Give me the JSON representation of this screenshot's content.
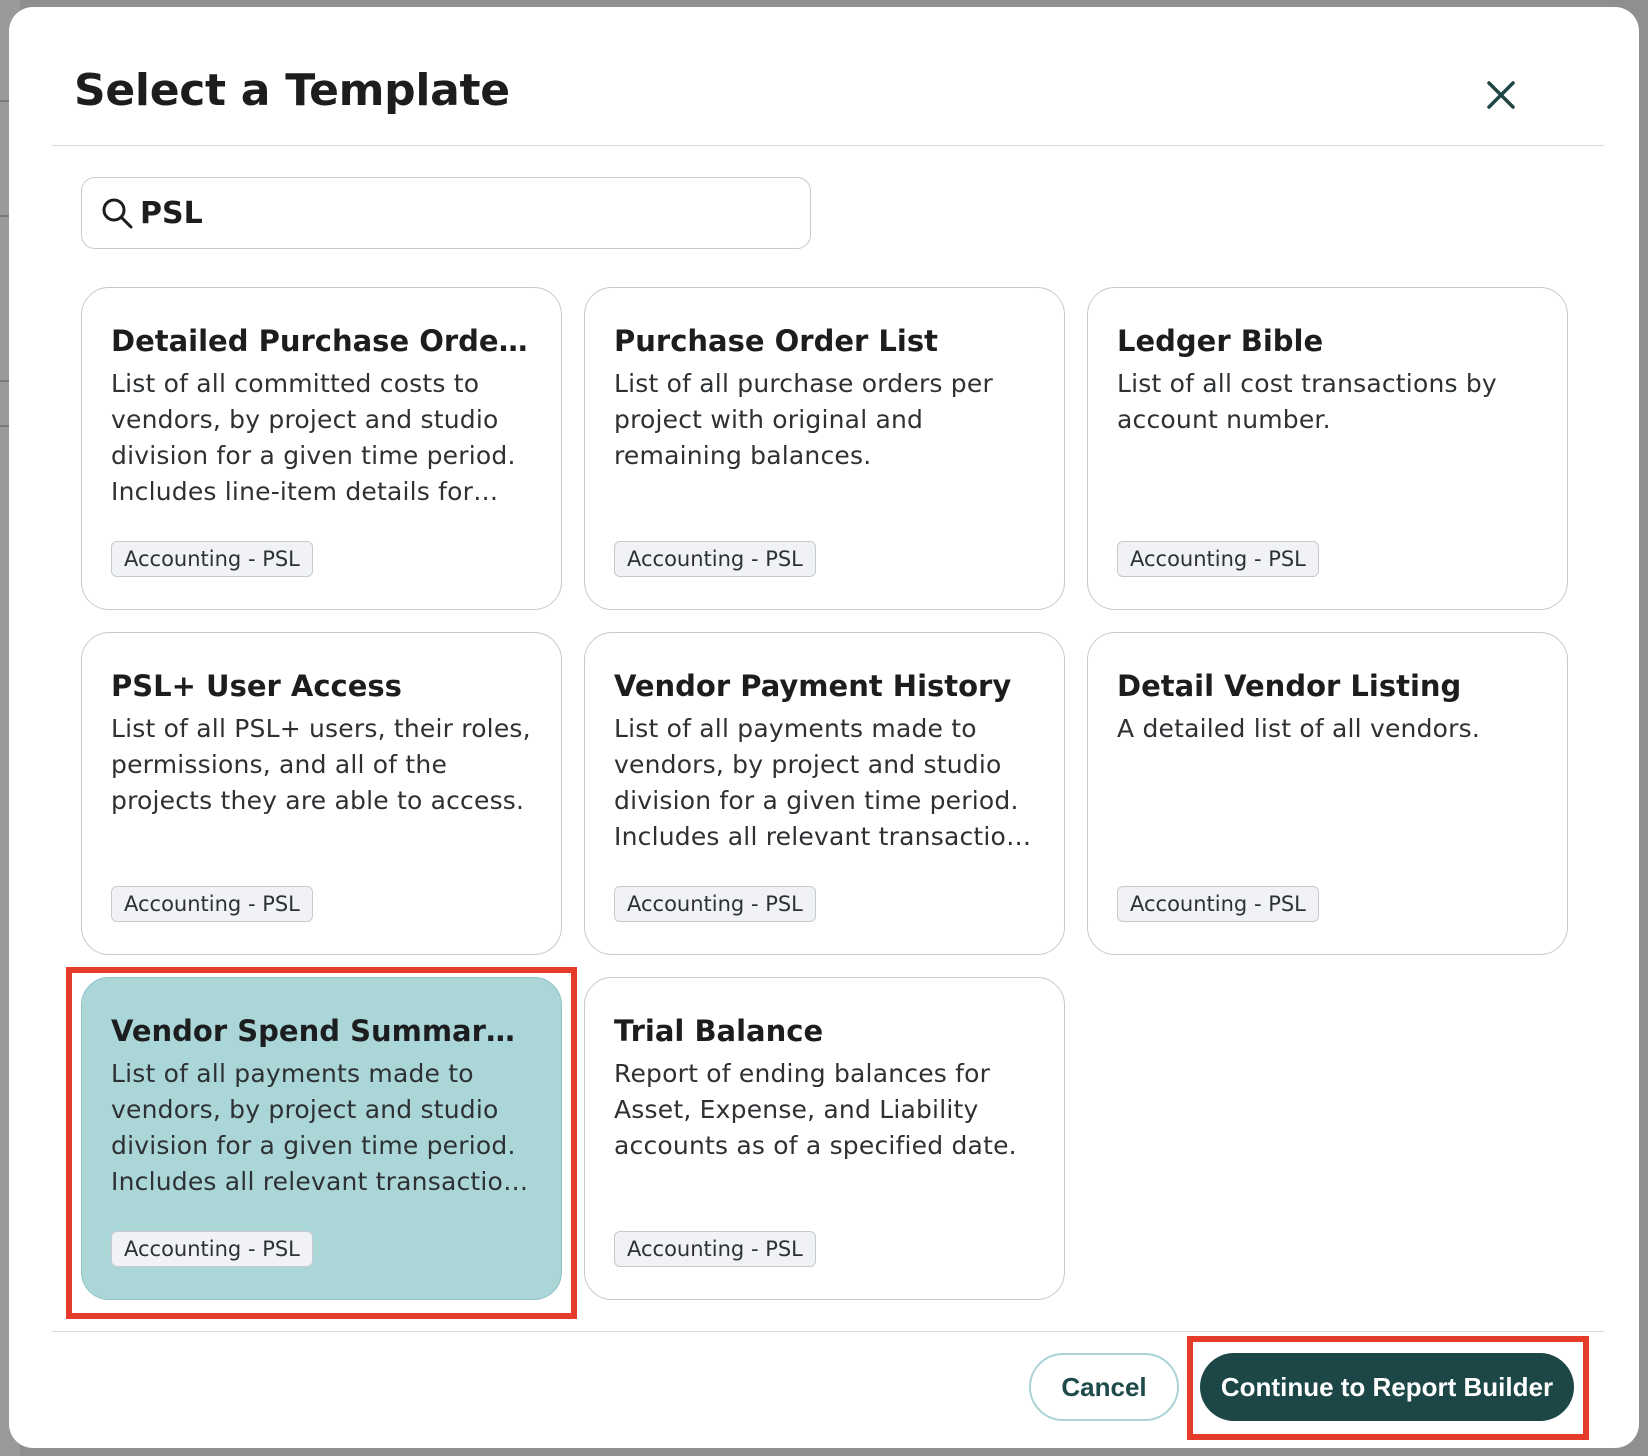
{
  "modal": {
    "title": "Select a Template",
    "close_icon": "close-icon"
  },
  "search": {
    "icon": "search-icon",
    "value": "PSL"
  },
  "templates": [
    {
      "title": "Detailed Purchase Order History",
      "description": "List of all committed costs to vendors, by project and studio division for a given time period. Includes line-item details for each purchase order.",
      "tag": "Accounting - PSL",
      "selected": false
    },
    {
      "title": "Purchase Order List",
      "description": "List of all purchase orders per project with original and remaining balances.",
      "tag": "Accounting - PSL",
      "selected": false
    },
    {
      "title": "Ledger Bible",
      "description": "List of all cost transactions by account number.",
      "tag": "Accounting - PSL",
      "selected": false
    },
    {
      "title": "PSL+ User Access",
      "description": "List of all PSL+ users, their roles, permissions, and all of the projects they are able to access.",
      "tag": "Accounting - PSL",
      "selected": false
    },
    {
      "title": "Vendor Payment History",
      "description": "List of all payments made to vendors, by project and studio division for a given time period. Includes all relevant transaction details.",
      "tag": "Accounting - PSL",
      "selected": false
    },
    {
      "title": "Detail Vendor Listing",
      "description": "A detailed list of all vendors.",
      "tag": "Accounting - PSL",
      "selected": false
    },
    {
      "title": "Vendor Spend Summary By Project",
      "description": "List of all payments made to vendors, by project and studio division for a given time period. Includes all relevant transaction details.",
      "tag": "Accounting - PSL",
      "selected": true
    },
    {
      "title": "Trial Balance",
      "description": "Report of ending balances for Asset, Expense, and Liability accounts as of a specified date.",
      "tag": "Accounting - PSL",
      "selected": false
    }
  ],
  "footer": {
    "cancel_label": "Cancel",
    "continue_label": "Continue to Report Builder"
  },
  "colors": {
    "selected_card": "#abd6d8",
    "primary_button": "#1d4747",
    "highlight_box": "#e43b2a"
  }
}
